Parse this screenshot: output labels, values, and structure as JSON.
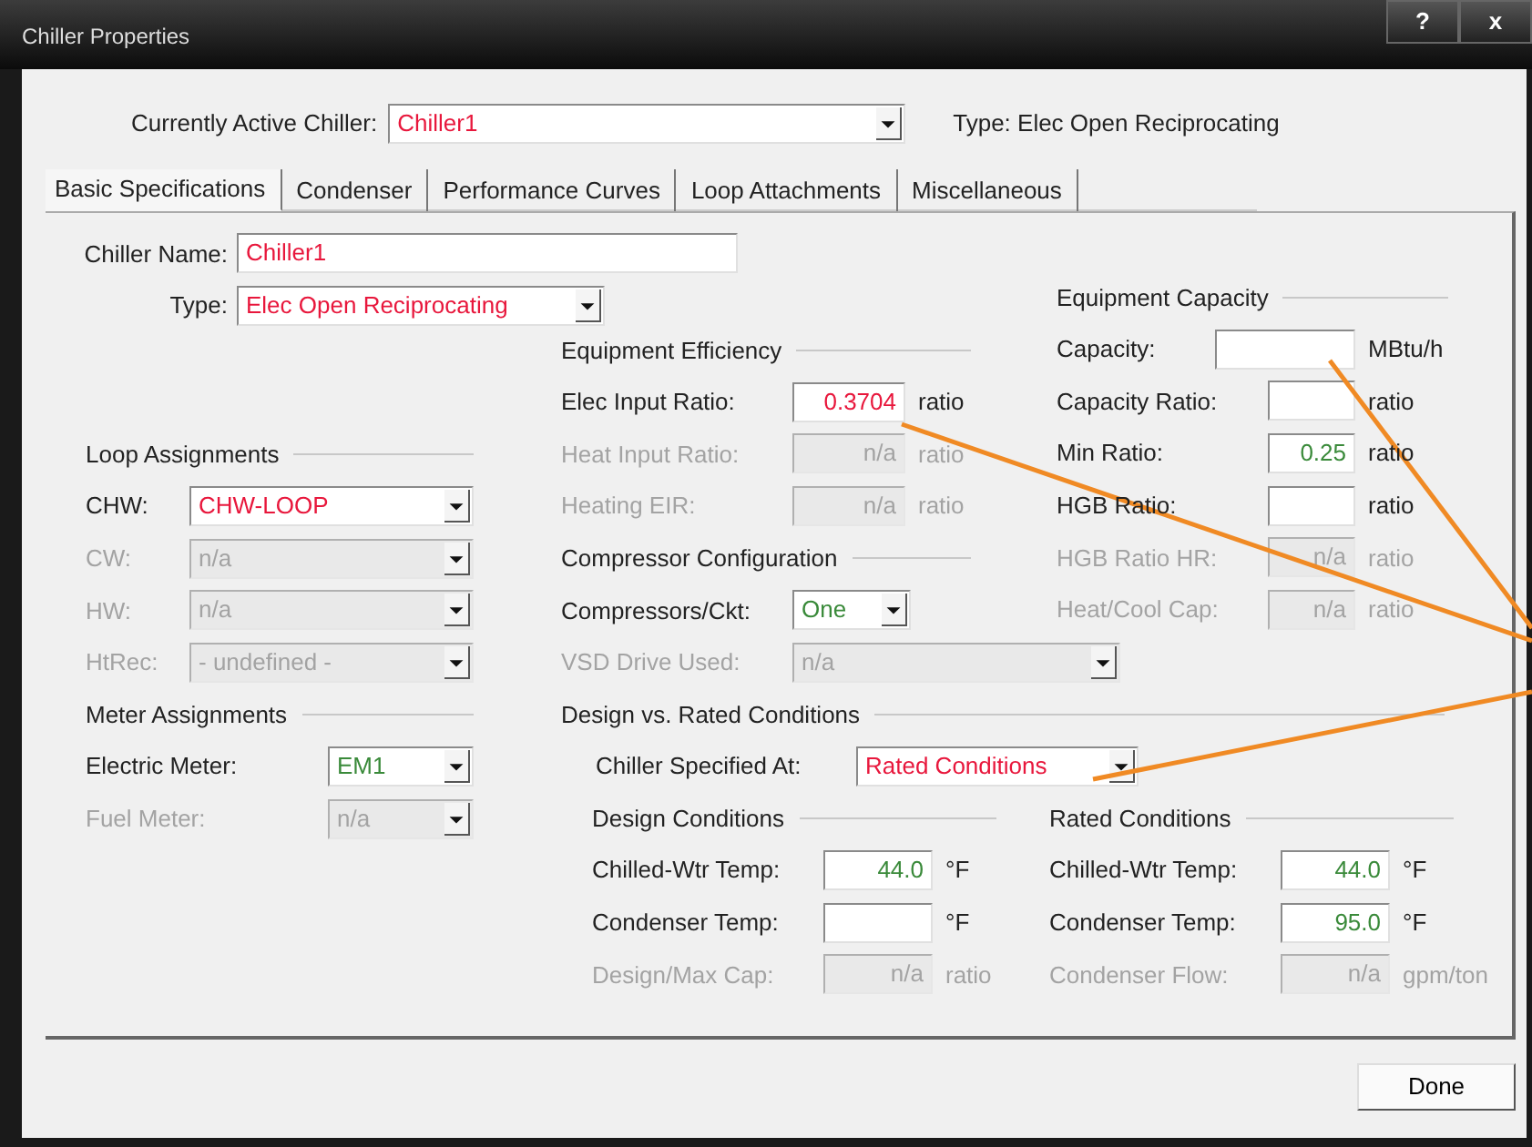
{
  "window": {
    "title": "Chiller Properties",
    "help_button": "?",
    "close_button": "x"
  },
  "active_chiller": {
    "label": "Currently Active Chiller:",
    "value": "Chiller1",
    "color": "#e8173c"
  },
  "type_label": "Type: Elec Open Reciprocating",
  "tabs": [
    {
      "label": "Basic Specifications",
      "selected": true
    },
    {
      "label": "Condenser",
      "selected": false
    },
    {
      "label": "Performance Curves",
      "selected": false
    },
    {
      "label": "Loop Attachments",
      "selected": false
    },
    {
      "label": "Miscellaneous",
      "selected": false
    }
  ],
  "left": {
    "fields": [
      {
        "kind": "text",
        "label": "Chiller Name:",
        "value": "Chiller1",
        "color": "#e8173c",
        "disabled": false
      },
      {
        "kind": "select",
        "label": "Type:",
        "value": "Elec Open Reciprocating",
        "color": "#e8173c",
        "disabled": false
      }
    ],
    "groups": [
      {
        "heading": "Loop Assignments",
        "fields": [
          {
            "kind": "select",
            "label": "CHW:",
            "value": "CHW-LOOP",
            "color": "#e8173c",
            "disabled": false
          },
          {
            "kind": "select",
            "label": "CW:",
            "value": "n/a",
            "disabled": true
          },
          {
            "kind": "select",
            "label": "HW:",
            "value": "n/a",
            "disabled": true
          },
          {
            "kind": "select",
            "label": "HtRec:",
            "value": "- undefined -",
            "disabled": true
          }
        ]
      },
      {
        "heading": "Meter Assignments",
        "fields": [
          {
            "kind": "select",
            "label": "Electric Meter:",
            "value": "EM1",
            "color": "#3a8a3a",
            "disabled": false
          },
          {
            "kind": "select",
            "label": "Fuel Meter:",
            "value": "n/a",
            "disabled": true
          }
        ]
      }
    ]
  },
  "middle": {
    "groups": [
      {
        "heading": "Equipment Efficiency",
        "fields": [
          {
            "kind": "number",
            "label": "Elec Input Ratio:",
            "value": "0.3704",
            "color": "#e8173c",
            "unit": "ratio",
            "disabled": false
          },
          {
            "kind": "number",
            "label": "Heat Input Ratio:",
            "value": "n/a",
            "unit": "ratio",
            "disabled": true
          },
          {
            "kind": "number",
            "label": "Heating EIR:",
            "value": "n/a",
            "unit": "ratio",
            "disabled": true
          }
        ]
      },
      {
        "heading": "Compressor Configuration",
        "fields": [
          {
            "kind": "select",
            "label": "Compressors/Ckt:",
            "value": "One",
            "color": "#3a8a3a",
            "disabled": false
          },
          {
            "kind": "select",
            "label": "VSD Drive Used:",
            "value": "n/a",
            "disabled": true
          }
        ]
      }
    ]
  },
  "right": {
    "groups": [
      {
        "heading": "Equipment Capacity",
        "fields": [
          {
            "kind": "number",
            "label": "Capacity:",
            "unit": "MBtu/h",
            "disabled": false
          },
          {
            "kind": "number",
            "label": "Capacity Ratio:",
            "unit": "ratio",
            "disabled": false
          },
          {
            "kind": "number",
            "label": "Min Ratio:",
            "value": "0.25",
            "color": "#3a8a3a",
            "unit": "ratio",
            "disabled": false
          },
          {
            "kind": "number",
            "label": "HGB Ratio:",
            "unit": "ratio",
            "disabled": false
          },
          {
            "kind": "number",
            "label": "HGB Ratio HR:",
            "value": "n/a",
            "unit": "ratio",
            "disabled": true
          },
          {
            "kind": "number",
            "label": "Heat/Cool Cap:",
            "value": "n/a",
            "unit": "ratio",
            "disabled": true
          }
        ]
      }
    ]
  },
  "design_vs_rated": {
    "heading": "Design vs. Rated Conditions",
    "fields": [
      {
        "kind": "select",
        "label": "Chiller Specified At:",
        "value": "Rated Conditions",
        "color": "#e8173c",
        "disabled": false
      }
    ],
    "groups": [
      {
        "heading": "Design Conditions",
        "fields": [
          {
            "kind": "number",
            "label": "Chilled-Wtr Temp:",
            "value": "44.0",
            "color": "#3a8a3a",
            "unit": "°F",
            "disabled": false
          },
          {
            "kind": "number",
            "label": "Condenser Temp:",
            "unit": "°F",
            "disabled": false
          },
          {
            "kind": "number",
            "label": "Design/Max Cap:",
            "value": "n/a",
            "unit": "ratio",
            "disabled": true
          }
        ]
      },
      {
        "heading": "Rated Conditions",
        "fields": [
          {
            "kind": "number",
            "label": "Chilled-Wtr Temp:",
            "value": "44.0",
            "color": "#3a8a3a",
            "unit": "°F",
            "disabled": false
          },
          {
            "kind": "number",
            "label": "Condenser Temp:",
            "value": "95.0",
            "color": "#3a8a3a",
            "unit": "°F",
            "disabled": false
          },
          {
            "kind": "number",
            "label": "Condenser Flow:",
            "value": "n/a",
            "unit": "gpm/ton",
            "disabled": true
          }
        ]
      }
    ]
  },
  "done_button": "Done"
}
